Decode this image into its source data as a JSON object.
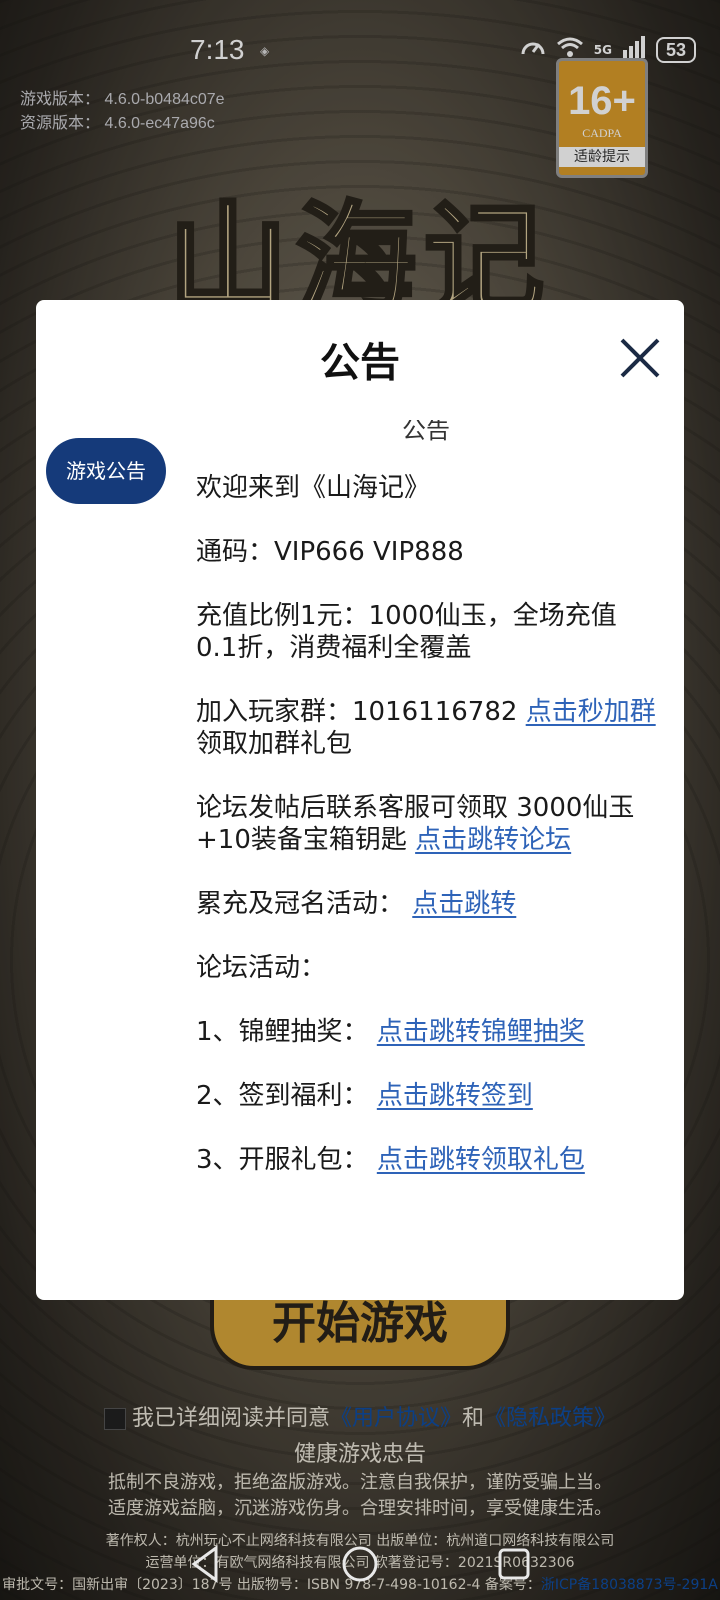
{
  "status_bar": {
    "time": "7:13",
    "network": "5G",
    "battery": "53"
  },
  "game": {
    "version_label": "游戏版本：",
    "version_value": "4.6.0-b0484c07e",
    "resource_label": "资源版本：",
    "resource_value": "4.6.0-ec47a96c",
    "title": "山海记",
    "age_rating": "16+",
    "age_org": "CADPA",
    "age_tip": "适龄提示",
    "start_button": "开始游戏",
    "agree_prefix": "我已详细阅读并同意",
    "user_agreement": "《用户协议》",
    "and": "和",
    "privacy_policy": "《隐私政策》",
    "health_title": "健康游戏忠告",
    "health_line1": "抵制不良游戏，拒绝盗版游戏。注意自我保护，谨防受骗上当。",
    "health_line2": "适度游戏益脑，沉迷游戏伤身。合理安排时间，享受健康生活。",
    "credit_line1": "著作权人：杭州玩心不止网络科技有限公司 出版单位：杭州道口网络科技有限公司",
    "credit_line2": "运营单位：有欧气网络科技有限公司 软著登记号：2021SR0632306",
    "credit_line3": "审批文号：国新出审〔2023〕187号 出版物号：ISBN 978-7-498-10162-4 备案号：",
    "icp": "浙ICP备18038873号-291A"
  },
  "modal": {
    "title": "公告",
    "side_tab": "游戏公告",
    "sub_title": "公告",
    "welcome": "欢迎来到《山海记》",
    "code": "通码：VIP666 VIP888",
    "recharge": "充值比例1元：1000仙玉，全场充值0.1折，消费福利全覆盖",
    "group_text": "加入玩家群：1016116782 ",
    "group_link": "点击秒加群",
    "group_suffix": " 领取加群礼包",
    "forum_text": "论坛发帖后联系客服可领取 3000仙玉+10装备宝箱钥匙 ",
    "forum_link": "点击跳转论坛",
    "event_text": "累充及冠名活动：  ",
    "event_link": "点击跳转",
    "forum_activity": "论坛活动：",
    "item1_text": "1、锦鲤抽奖：  ",
    "item1_link": "点击跳转锦鲤抽奖",
    "item2_text": "2、签到福利：  ",
    "item2_link": "点击跳转签到",
    "item3_text": "3、开服礼包：  ",
    "item3_link": "点击跳转领取礼包"
  }
}
